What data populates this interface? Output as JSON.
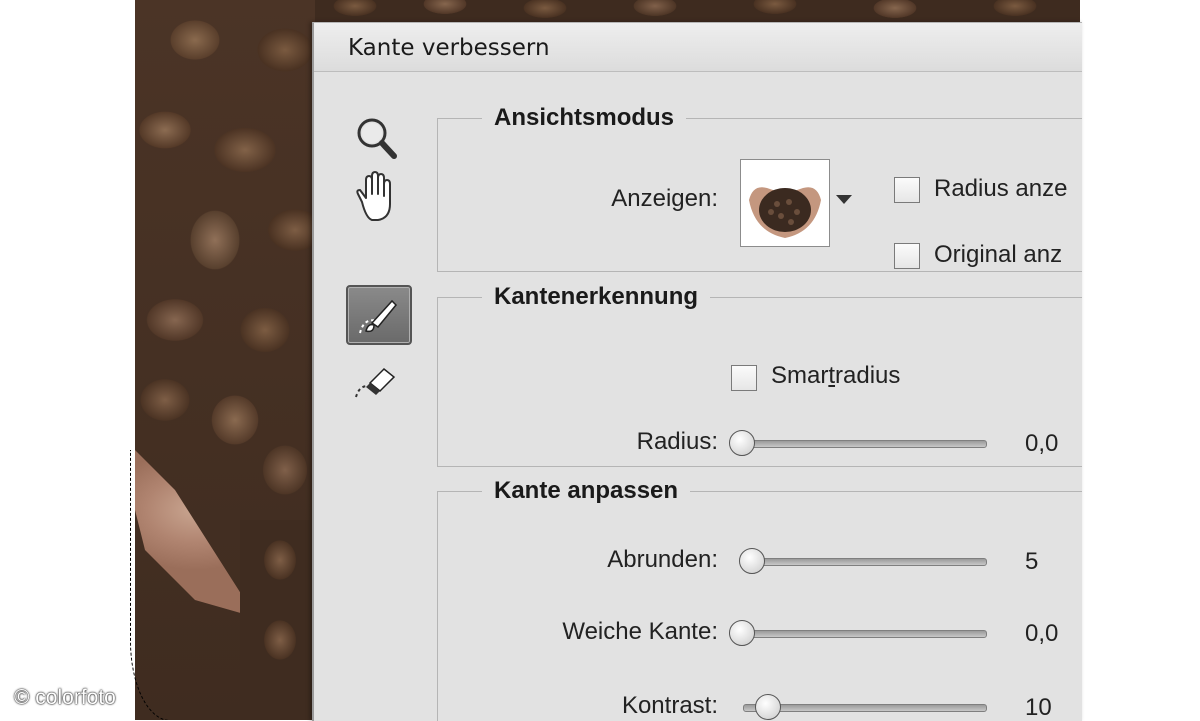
{
  "dialog": {
    "title": "Kante verbessern"
  },
  "watermark": "© colorfoto",
  "tools": {
    "zoom": "zoom-icon",
    "hand": "hand-icon",
    "refine_radius": "refine-radius-brush-icon",
    "erase_refinements": "erase-refinements-icon"
  },
  "view_mode": {
    "title": "Ansichtsmodus",
    "show_label": "Anzeigen:",
    "show_radius_label": "Radius anze",
    "show_original_label": "Original anz"
  },
  "edge_detection": {
    "title": "Kantenerkennung",
    "smart_radius_pre": "Smar",
    "smart_radius_u": "t",
    "smart_radius_post": "radius",
    "radius_label": "Radius:",
    "radius_value": "0,0"
  },
  "adjust_edge": {
    "title": "Kante anpassen",
    "smooth_label": "Abrunden:",
    "smooth_value": "5",
    "feather_label": "Weiche Kante:",
    "feather_value": "0,0",
    "contrast_label": "Kontrast:",
    "contrast_value": "10"
  },
  "colors": {
    "dialog_bg": "#e2e2e2",
    "text": "#222222"
  }
}
